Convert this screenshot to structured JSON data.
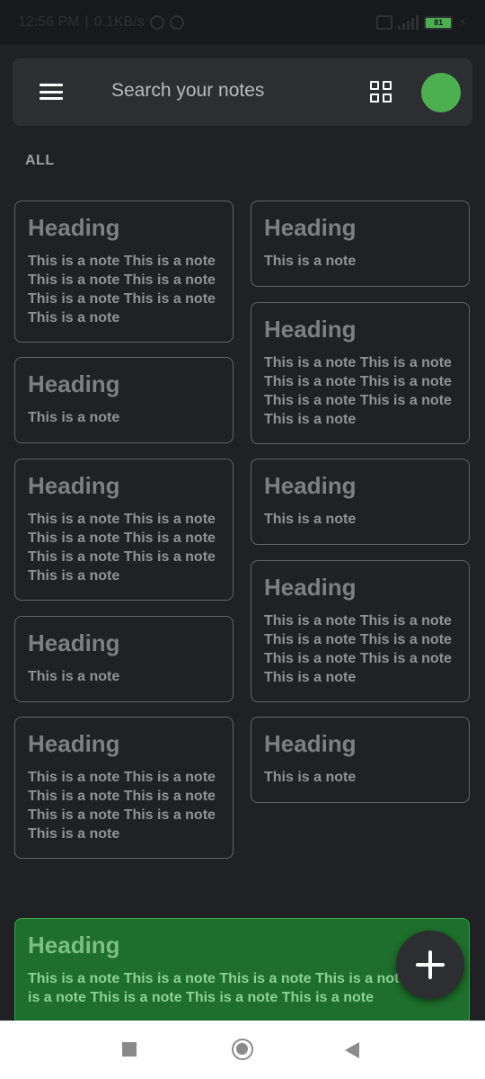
{
  "status_bar": {
    "time": "12:56 PM",
    "network_speed": "0.1KB/s",
    "battery": "81"
  },
  "search": {
    "placeholder": "Search your notes"
  },
  "section": {
    "label": "ALL"
  },
  "notes": [
    {
      "heading": "Heading",
      "body": "This is a note This is a note This is a note This is a note This is a note This is a note This is a note"
    },
    {
      "heading": "Heading",
      "body": "This is a note"
    },
    {
      "heading": "Heading",
      "body": "This is a note"
    },
    {
      "heading": "Heading",
      "body": "This is a note This is a note This is a note This is a note This is a note This is a note This is a note"
    },
    {
      "heading": "Heading",
      "body": "This is a note This is a note This is a note This is a note This is a note This is a note This is a note"
    },
    {
      "heading": "Heading",
      "body": "This is a note"
    },
    {
      "heading": "Heading",
      "body": "This is a note"
    },
    {
      "heading": "Heading",
      "body": "This is a note This is a note This is a note This is a note This is a note This is a note This is a note"
    },
    {
      "heading": "Heading",
      "body": "This is a note This is a note This is a note This is a note This is a note This is a note This is a note"
    },
    {
      "heading": "Heading",
      "body": "This is a note"
    }
  ],
  "pinned_note": {
    "heading": "Heading",
    "body": "This is a note This is a note This is a note This is a note This is a note This is a note This is a note This is a note",
    "color": "#1d6f2b"
  },
  "colors": {
    "background": "#202124",
    "accent": "#4caf50"
  },
  "icons": {
    "menu": "menu-icon",
    "layout": "grid-view-icon",
    "add": "plus-icon"
  }
}
